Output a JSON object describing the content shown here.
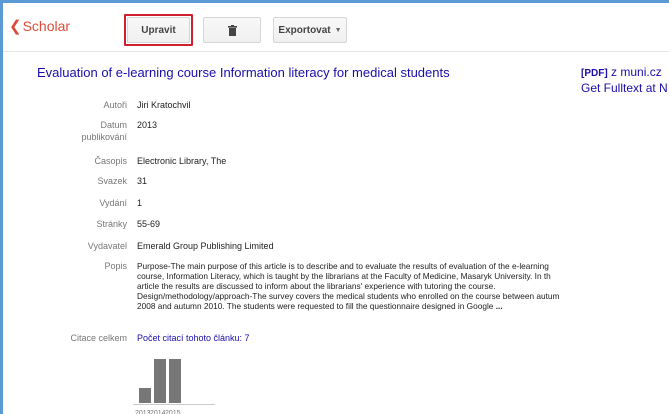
{
  "toolbar": {
    "back_label": "Scholar",
    "edit_label": "Upravit",
    "export_label": "Exportovat"
  },
  "article": {
    "title": "Evaluation of e-learning course Information literacy for medical students",
    "fulltext_pdf_tag": "[PDF]",
    "fulltext_source": "z muni.cz",
    "fulltext_link": "Get Fulltext at N"
  },
  "fields": {
    "authors": {
      "label": "Autoři",
      "value": "Jiri Kratochvil"
    },
    "date": {
      "label_line1": "Datum",
      "label_line2": "publikování",
      "value": "2013"
    },
    "journal": {
      "label": "Časopis",
      "value": "Electronic Library, The"
    },
    "volume": {
      "label": "Svazek",
      "value": "31"
    },
    "issue": {
      "label": "Vydání",
      "value": "1"
    },
    "pages": {
      "label": "Stránky",
      "value": "55-69"
    },
    "publisher": {
      "label": "Vydavatel",
      "value": "Emerald Group Publishing Limited"
    },
    "description": {
      "label": "Popis",
      "lines": [
        "Purpose-The main purpose of this article is to describe and to evaluate the results of evaluation of the e-learning",
        "course, Information Literacy, which is taught by the librarians at the Faculty of Medicine, Masaryk University. In th",
        "article the results are discussed to inform about the librarians' experience with tutoring the course.",
        "Design/methodology/approach-The survey covers the medical students who enrolled on the course between autum",
        "2008 and autumn 2010. The students were requested to fill the questionnaire designed in Google"
      ],
      "ellipsis": "..."
    },
    "citations": {
      "label": "Citace celkem",
      "value": "Počet citací tohoto článku: 7"
    }
  },
  "chart_data": {
    "type": "bar",
    "categories": [
      "2013",
      "2014",
      "2015"
    ],
    "values": [
      1,
      3,
      3
    ],
    "ylim": [
      0,
      3
    ]
  },
  "colors": {
    "accent_red": "#dd4b39",
    "link_blue": "#1a0dab",
    "frame_blue": "#5b9bd5",
    "highlight_red": "#d0202e",
    "bar_gray": "#777777"
  }
}
